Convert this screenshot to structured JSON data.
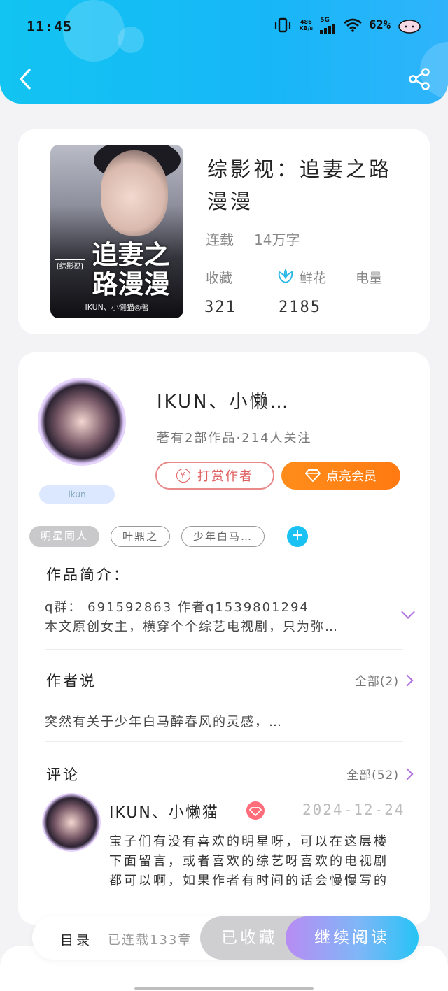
{
  "status_bar": {
    "time": "11:45",
    "net_speed": "486\nKB/s",
    "signal": "5G",
    "battery": "62%"
  },
  "book": {
    "cover_title": "追妻之\n路漫漫",
    "cover_tag": "[综影视]",
    "cover_author": "IKUN、小懒猫◎著",
    "title": "综影视：追妻之路漫漫",
    "status": "连载",
    "word_count": "14万字",
    "stats": [
      {
        "label": "收藏",
        "value": "321"
      },
      {
        "label": "鲜花",
        "value": "2185"
      },
      {
        "label": "电量",
        "value": ""
      }
    ]
  },
  "author": {
    "badge": "ikun",
    "name": "IKUN、小懒…",
    "info": "著有2部作品·214人关注",
    "tip_label": "打赏作者",
    "vip_label": "点亮会员"
  },
  "tags": [
    "明星同人",
    "叶鼎之",
    "少年白马…"
  ],
  "intro": {
    "title": "作品简介：",
    "line1": "q群： 691592863  作者q1539801294",
    "line2": "本文原创女主，横穿个个综艺电视剧，只为弥…"
  },
  "author_says": {
    "title": "作者说",
    "more": "全部(2)",
    "text": "突然有关于少年白马醉春风的灵感，…"
  },
  "comments": {
    "title": "评论",
    "more": "全部(52)",
    "items": [
      {
        "user": "IKUN、小懒猫",
        "date": "2024-12-24",
        "text": "宝子们有没有喜欢的明星呀，可以在这层楼下面留言，或者喜欢的综艺呀喜欢的电视剧都可以啊，如果作者有时间的话会慢慢写的"
      }
    ]
  },
  "bottom": {
    "toc": "目录",
    "chapters": "已连载133章",
    "collected": "已收藏",
    "read": "继续阅读"
  },
  "colors": {
    "accent": "#17b7f7",
    "vip": "#ff8d1a",
    "purple": "#b06fe0"
  }
}
